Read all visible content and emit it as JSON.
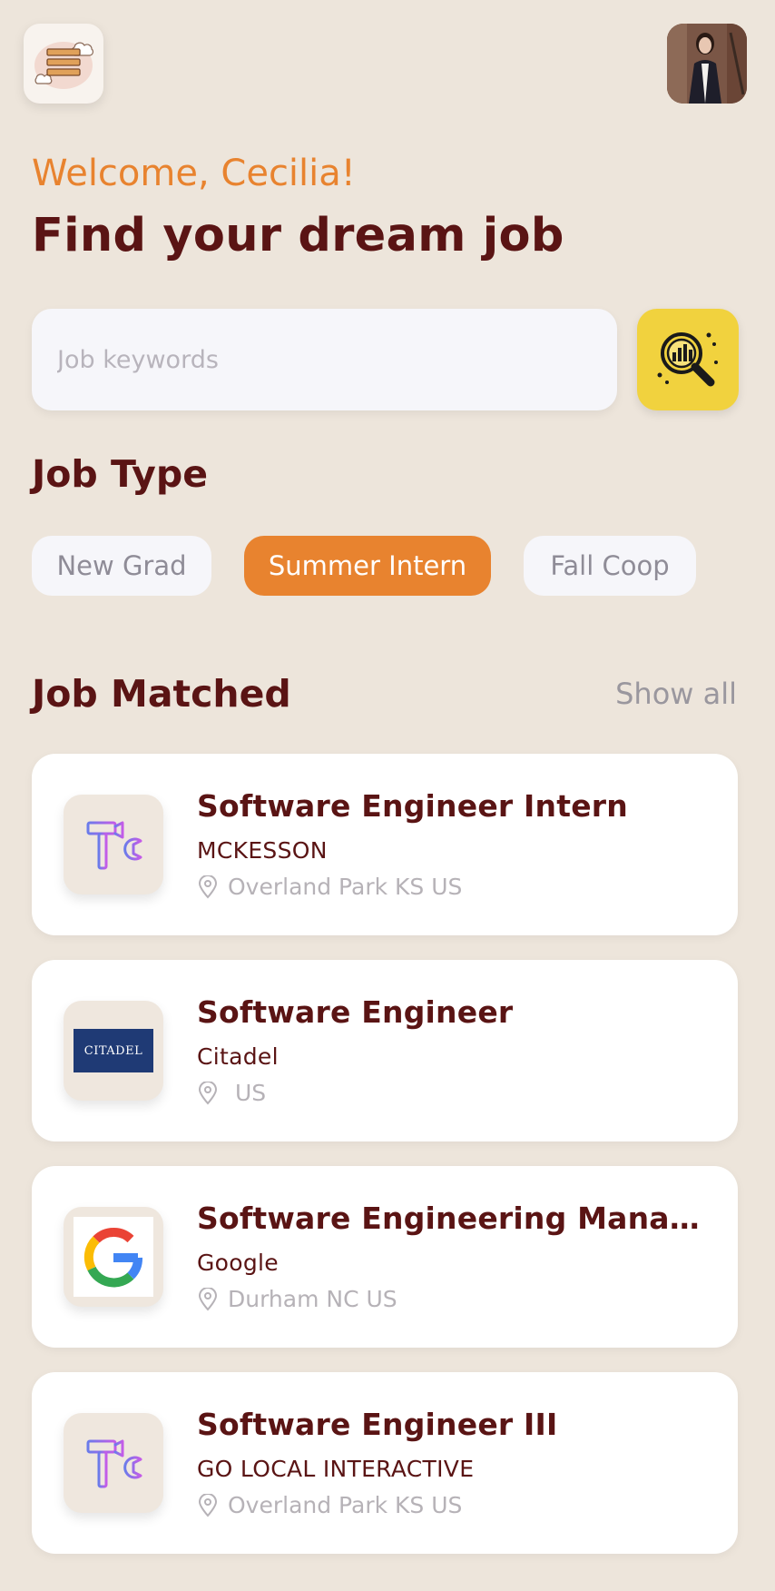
{
  "header": {
    "welcome": "Welcome, Cecilia!",
    "headline": "Find your dream job"
  },
  "search": {
    "placeholder": "Job keywords",
    "value": ""
  },
  "job_type": {
    "title": "Job Type",
    "chips": [
      {
        "label": "New Grad",
        "active": false
      },
      {
        "label": "Summer Intern",
        "active": true
      },
      {
        "label": "Fall Coop",
        "active": false
      }
    ]
  },
  "matched": {
    "title": "Job Matched",
    "show_all": "Show all",
    "jobs": [
      {
        "title": "Software Engineer Intern",
        "company": "MCKESSON",
        "location": "Overland Park KS US",
        "logo": "tools-icon"
      },
      {
        "title": "Software Engineer",
        "company": "Citadel",
        "location": " US",
        "logo": "citadel-logo",
        "logo_text": "CITADEL"
      },
      {
        "title": "Software Engineering Manag...",
        "company": "Google",
        "location": "Durham NC US",
        "logo": "google-logo"
      },
      {
        "title": "Software Engineer III",
        "company": "GO LOCAL INTERACTIVE",
        "location": "Overland Park KS US",
        "logo": "tools-icon"
      }
    ]
  },
  "colors": {
    "background": "#EDE5DB",
    "accent": "#E8832F",
    "heading": "#5A1414",
    "search_button": "#F1D23E",
    "muted": "#9A979E"
  }
}
